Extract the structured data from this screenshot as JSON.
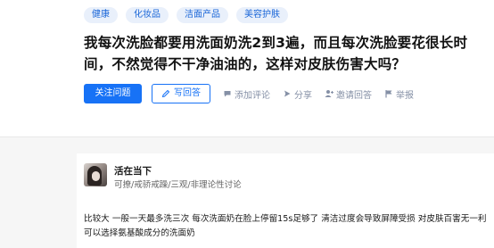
{
  "topics": [
    "健康",
    "化妆品",
    "洁面产品",
    "美容护肤"
  ],
  "question": {
    "title": "我每次洗脸都要用洗面奶洗2到3遍，而且每次洗脸要花很长时间，不然觉得不干净油油的，这样对皮肤伤害大吗？"
  },
  "actions": {
    "follow_label": "关注问题",
    "answer_label": "写回答",
    "comment_label": "添加评论",
    "share_label": "分享",
    "invite_label": "邀请回答",
    "report_label": "举报"
  },
  "answer": {
    "author_name": "活在当下",
    "author_bio": "可撩/戒骄戒躁/三观/非理论性讨论",
    "text": "比较大 一般一天最多洗三次 每次洗面奶在脸上停留15s足够了 清洁过度会导致屏障受损 对皮肤百害无一利 可以选择氨基酸成分的洗面奶"
  },
  "colors": {
    "accent": "#1772f6",
    "tag_bg": "#e9f0fb",
    "muted": "#8590a6"
  }
}
